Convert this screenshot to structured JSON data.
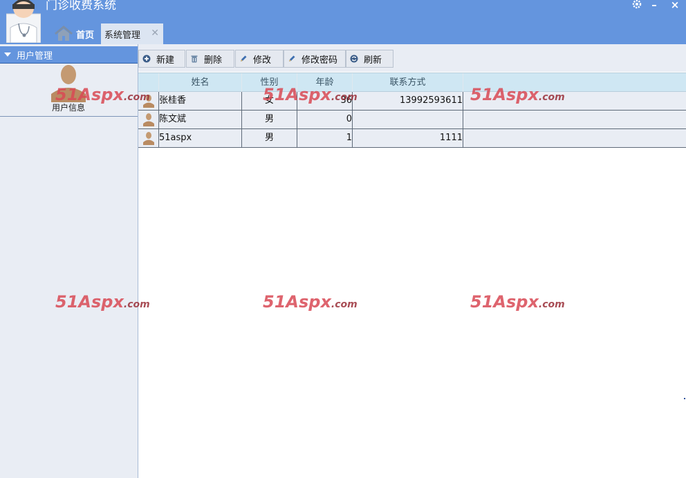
{
  "app": {
    "title": "门诊收费系统",
    "controls": {
      "min": "–",
      "close": "×"
    }
  },
  "nav": {
    "home_label": "首页",
    "tab_label": "系统管理",
    "tab_close": "✕"
  },
  "sidebar": {
    "header": "用户管理",
    "items": [
      {
        "label": "用户信息"
      }
    ]
  },
  "toolbar": {
    "buttons": [
      {
        "label": "新建",
        "icon": "plus-icon"
      },
      {
        "label": "删除",
        "icon": "trash-icon"
      },
      {
        "label": "修改",
        "icon": "edit-icon"
      },
      {
        "label": "修改密码",
        "icon": "edit-password-icon"
      },
      {
        "label": "刷新",
        "icon": "refresh-icon"
      }
    ]
  },
  "grid": {
    "columns": [
      "姓名",
      "性别",
      "年龄",
      "联系方式"
    ],
    "rows": [
      {
        "name": "张桂香",
        "sex": "女",
        "age": "36",
        "phone": "13992593611"
      },
      {
        "name": "陈文斌",
        "sex": "男",
        "age": "0",
        "phone": ""
      },
      {
        "name": "51aspx",
        "sex": "男",
        "age": "1",
        "phone": "1111"
      }
    ]
  },
  "watermark": {
    "main": "51Aspx",
    "suffix": ".com"
  },
  "colors": {
    "accent": "#6495de",
    "header_bg": "#cfe7f3",
    "row_bg": "#e9edf4",
    "watermark": "#d94a55"
  }
}
